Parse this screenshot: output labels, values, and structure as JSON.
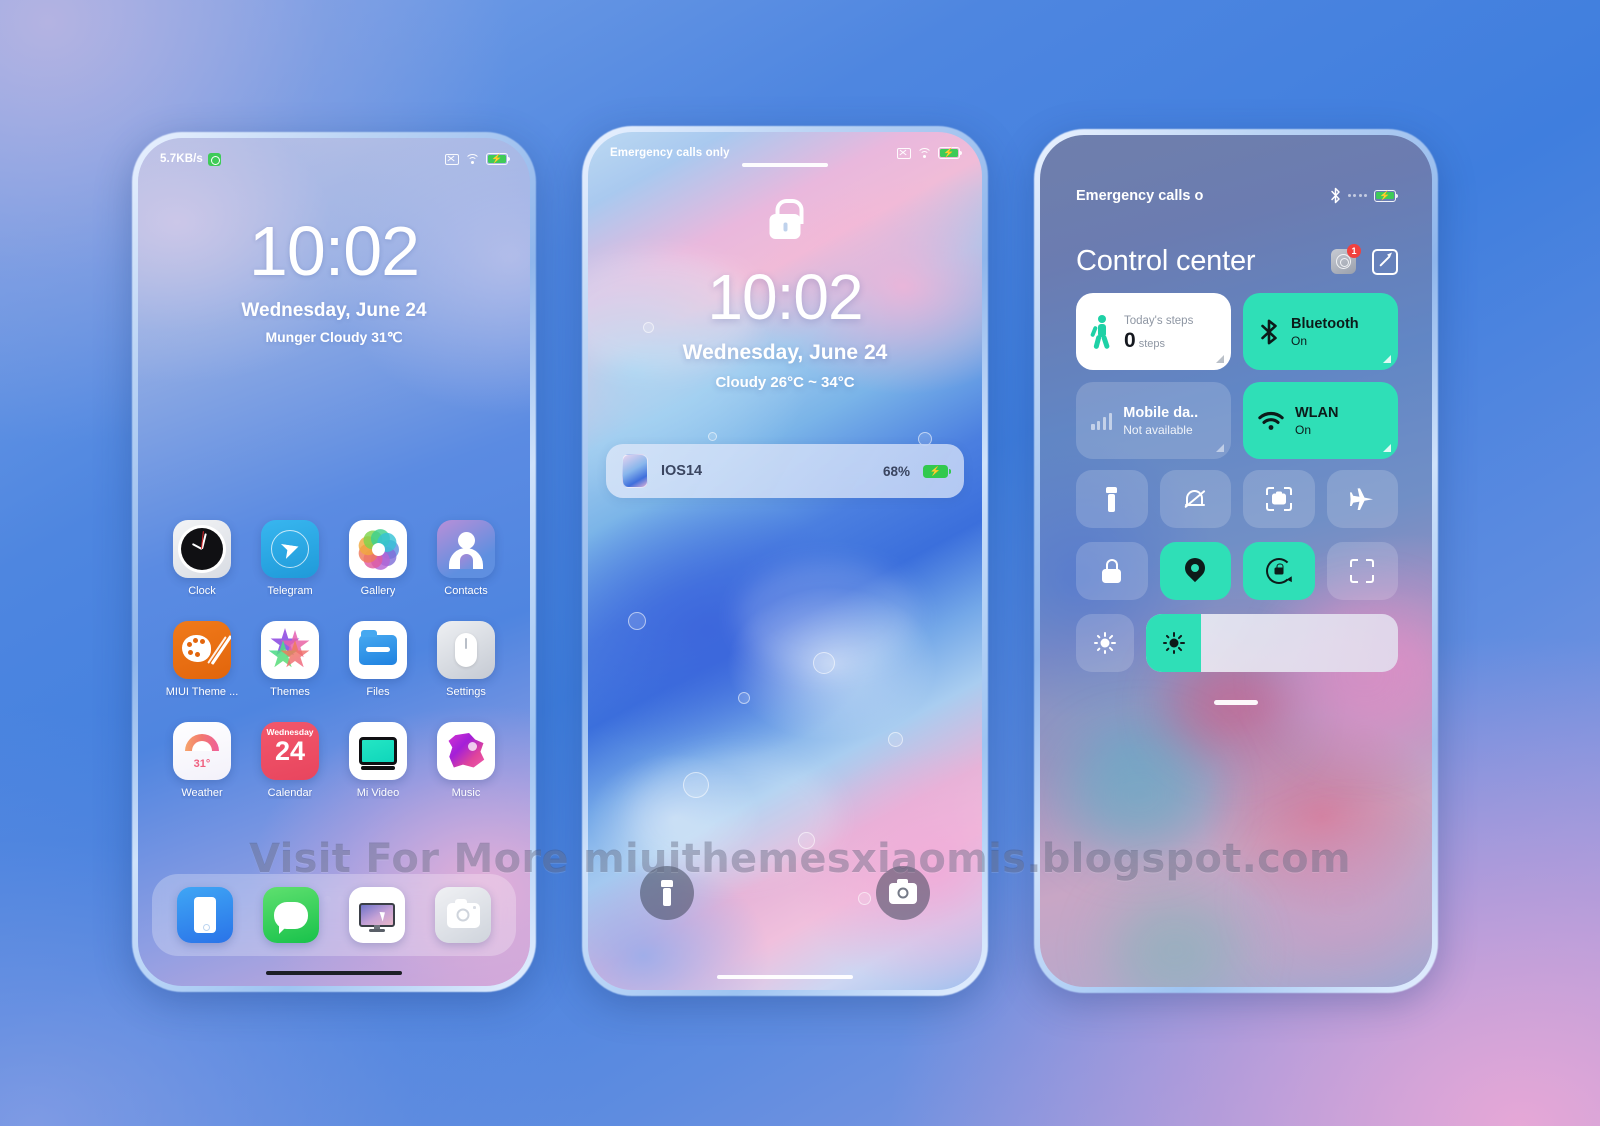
{
  "watermark": "Visit For More miuithemesxiaomis.blogspot.com",
  "home": {
    "status": {
      "speed": "5.7KB/s",
      "alarm_icon": "alarm-badge-icon",
      "nosim_icon": "no-sim-icon",
      "wifi_icon": "wifi-icon",
      "battery_icon": "battery-charging-icon"
    },
    "clock": {
      "time": "10:02",
      "date": "Wednesday, June 24",
      "weather": "Munger  Cloudy  31℃"
    },
    "apps": [
      {
        "label": "Clock",
        "icon": "clock-icon"
      },
      {
        "label": "Telegram",
        "icon": "telegram-icon"
      },
      {
        "label": "Gallery",
        "icon": "gallery-icon"
      },
      {
        "label": "Contacts",
        "icon": "contacts-icon"
      },
      {
        "label": "MIUI Theme ...",
        "icon": "miui-theme-icon"
      },
      {
        "label": "Themes",
        "icon": "themes-icon"
      },
      {
        "label": "Files",
        "icon": "files-icon"
      },
      {
        "label": "Settings",
        "icon": "settings-icon"
      },
      {
        "label": "Weather",
        "icon": "weather-icon"
      },
      {
        "label": "Calendar",
        "icon": "calendar-icon"
      },
      {
        "label": "Mi Video",
        "icon": "mi-video-icon"
      },
      {
        "label": "Music",
        "icon": "music-icon"
      }
    ],
    "weather_widget": {
      "temp": "31°"
    },
    "calendar_widget": {
      "weekday": "Wednesday",
      "day": "24"
    },
    "dock": [
      {
        "label": "Phone",
        "icon": "phone-icon"
      },
      {
        "label": "Messages",
        "icon": "messages-icon"
      },
      {
        "label": "Remote Desktop",
        "icon": "remote-desktop-icon"
      },
      {
        "label": "Camera",
        "icon": "camera-icon"
      }
    ]
  },
  "lockscreen": {
    "status": {
      "carrier": "Emergency calls only",
      "nosim_icon": "no-sim-icon",
      "wifi_icon": "wifi-icon",
      "battery_icon": "battery-charging-icon"
    },
    "lock_icon": "padlock-icon",
    "clock": {
      "time": "10:02",
      "date": "Wednesday, June 24",
      "weather": "Cloudy  26°C ~ 34°C"
    },
    "notification": {
      "title": "IOS14",
      "battery_pct": "68%",
      "thumb": "theme-thumbnail",
      "battery_icon": "battery-charging-icon"
    },
    "actions": [
      {
        "name": "flashlight",
        "icon": "flashlight-icon"
      },
      {
        "name": "camera",
        "icon": "camera-icon"
      }
    ]
  },
  "control_center": {
    "status": {
      "carrier": "Emergency calls o",
      "bluetooth_icon": "bluetooth-icon",
      "signal_icon": "signal-dots-icon",
      "battery_icon": "battery-charging-icon"
    },
    "title": "Control center",
    "header_icons": [
      {
        "name": "settings-shortcut",
        "icon": "gear-icon",
        "badge": "1"
      },
      {
        "name": "edit-toggles",
        "icon": "edit-pencil-icon"
      }
    ],
    "tiles": [
      {
        "name": "steps",
        "title": "Today's steps",
        "value": "0",
        "unit": "steps",
        "state": "white",
        "icon": "walking-person-icon"
      },
      {
        "name": "bluetooth",
        "title": "Bluetooth",
        "sub": "On",
        "state": "on",
        "icon": "bluetooth-icon"
      },
      {
        "name": "mobile-data",
        "title": "Mobile da..",
        "sub": "Not available",
        "state": "off",
        "icon": "signal-bars-icon"
      },
      {
        "name": "wlan",
        "title": "WLAN",
        "sub": "On",
        "state": "on",
        "icon": "wifi-icon"
      }
    ],
    "toggles": [
      {
        "name": "flashlight",
        "icon": "flashlight-icon",
        "state": "off"
      },
      {
        "name": "silent",
        "icon": "bell-muted-icon",
        "state": "off"
      },
      {
        "name": "screenshot",
        "icon": "screenshot-icon",
        "state": "off"
      },
      {
        "name": "airplane-mode",
        "icon": "airplane-icon",
        "state": "off"
      },
      {
        "name": "lock-screen",
        "icon": "padlock-icon",
        "state": "off"
      },
      {
        "name": "location",
        "icon": "location-pin-icon",
        "state": "on"
      },
      {
        "name": "rotation-lock",
        "icon": "rotation-lock-icon",
        "state": "on"
      },
      {
        "name": "scanner",
        "icon": "scan-frame-icon",
        "state": "off"
      }
    ],
    "brightness": {
      "auto_icon": "brightness-auto-icon",
      "slider_icon": "brightness-icon",
      "level_pct": 15
    }
  },
  "colors": {
    "accent_teal": "#2fdfb7",
    "battery_green": "#31c94e",
    "badge_red": "#f0413f",
    "calendar_red": "#e8455e",
    "miui_orange": "#e2650c",
    "page_bg_blue": "#4e86e0"
  }
}
